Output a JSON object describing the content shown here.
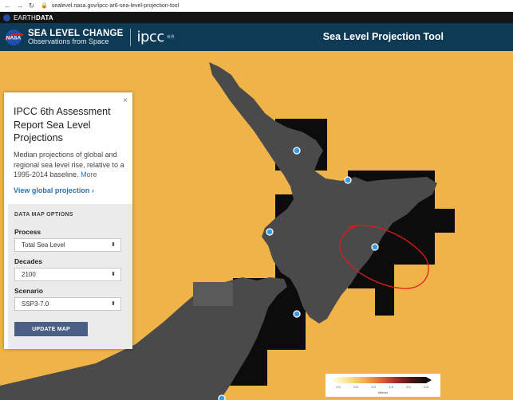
{
  "browser": {
    "back_icon": "back-arrow-icon",
    "forward_icon": "forward-arrow-icon",
    "reload_icon": "reload-icon",
    "back_glyph": "←",
    "forward_glyph": "→",
    "reload_glyph": "↻",
    "url": "sealevel.nasa.gov/ipcc-ar6-sea-level-projection-tool"
  },
  "earthdata": {
    "prefix": "EARTH",
    "bold": "DATA"
  },
  "header": {
    "brand_title": "SEA LEVEL CHANGE",
    "brand_subtitle": "Observations from Space",
    "partner": "ipcc",
    "partner_sub": "世界",
    "tool_title": "Sea Level Projection Tool"
  },
  "panel": {
    "close": "×",
    "title": "IPCC 6th Assessment Report Sea Level Projections",
    "description": "Median projections of global and regional sea level rise, relative to a 1995-2014 baseline.",
    "more_link": "More",
    "global_link": "View global projection ›",
    "options_heading": "DATA MAP OPTIONS",
    "process": {
      "label": "Process",
      "value": "Total Sea Level"
    },
    "decades": {
      "label": "Decades",
      "value": "2100"
    },
    "scenario": {
      "label": "Scenario",
      "value": "SSP3-7.0"
    },
    "update_button": "UPDATE MAP"
  },
  "legend": {
    "ticks": [
      "0.0",
      "0.5",
      "1.0",
      "1.5",
      "2.0",
      "2.5"
    ],
    "unit": "Meters"
  },
  "colors": {
    "ocean": "#efb348",
    "land": "#4a4a4a",
    "header_bg": "#0f3a56",
    "marker": "#3b9be0",
    "annotation": "#e21b1b",
    "update_button": "#4a5f83"
  }
}
